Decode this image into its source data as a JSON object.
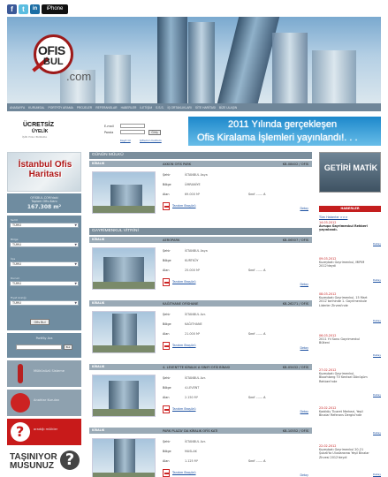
{
  "social": {
    "facebook": "f",
    "twitter": "t",
    "linkedin": "in",
    "iphone": "iPhone"
  },
  "logo": {
    "ofis": "OFIS",
    "bul": "BUL",
    "com": ".com"
  },
  "nav": [
    "ANASAYFA",
    "KURUMSAL",
    "PORTFÖY ARAMA",
    "PROJELER",
    "REFERANSLAR",
    "HABERLER",
    "İLETİŞİM",
    "S.S.S.",
    "İŞ ORTAKLIKLARI",
    "SİTE HARİTASI",
    "BİZE ULAŞIN"
  ],
  "member": {
    "title": "ÜCRETSİZ",
    "subtitle": "ÜYELİK",
    "small": "İŞİN YOLU BURADA",
    "email_label": "E-mail",
    "password_label": "Parola",
    "login_button": "Giriş",
    "register_link": "Kayıt Ol",
    "forgot_link": "Şifremi Unuttum"
  },
  "banner": {
    "line1": "2011 Yılında gerçekleşen",
    "line2": "Ofis Kiralama İşlemleri yayınlandı!. . ."
  },
  "left": {
    "istanbul_map": "İstanbul Ofis Haritası",
    "stat_line1": "OFİSBUL.COM'daki",
    "stat_line2": "Toplam Ofis Alanı",
    "stat_value": "167.308 m²",
    "search_labels": [
      "Semt",
      "Bölge",
      "İlçe",
      "Durum",
      "Fiyat Aralığı"
    ],
    "search_values": [
      "TÜMÜ",
      "TÜMÜ",
      "TÜMÜ",
      "TÜMÜ",
      "TÜMÜ"
    ],
    "search_button": "Ofis Bul",
    "portfoy_title": "Portföy Ara",
    "portfoy_button": "Bul",
    "banner1": "Mülkünüzü Sisteme",
    "banner2": "Anahtar Kurulan",
    "banner3": "aradığı mülkler",
    "tasiyor1": "TAŞINIYOR",
    "tasiyor2": "MUSUNUZ"
  },
  "main": {
    "section1": "GÜNÜN MÜLKÜ",
    "section2": "GAYRİMENKUL VİTRİNİ",
    "labels": {
      "sehir": "Şehir",
      "bolge": "Bölge",
      "alan": "Alan",
      "sinif": "Sınıf",
      "tanitim": "Tanıtım Broşürü",
      "detay": "Detay"
    },
    "listings": [
      {
        "type": "KİRALIK",
        "title": "AKKON OFİS PARK",
        "code": "KB-08402 / OFİS",
        "city": "İSTANBUL Asya",
        "region": "ÜMRANİYE",
        "area": "69.000 M²",
        "class": "A"
      },
      {
        "type": "KİRALIK",
        "title": "AEROPARK",
        "code": "KB-06507 / OFİS",
        "city": "İSTANBUL Asya",
        "region": "KURTKÖY",
        "area": "25.000 M²",
        "class": "A"
      },
      {
        "type": "KİRALIK",
        "title": "KAĞITHANE OFİSHANE",
        "code": "KB-26271 / OFİS",
        "city": "İSTANBUL Avr.",
        "region": "KAĞITHANE",
        "area": "21.000 M²",
        "class": "A"
      },
      {
        "type": "KİRALIK",
        "title": "4. LEVENT'TE KİRALIK A SINIFI OFİS BİNASI",
        "code": "KB-05432 / OFİS",
        "city": "İSTANBUL Avr.",
        "region": "4.LEVENT",
        "area": "2.150 M²",
        "class": "A"
      },
      {
        "type": "KİRALIK",
        "title": "PARK PLAZA' DA KİRALIK OFİS KATI",
        "code": "KB-10552 / OFİS",
        "city": "İSTANBUL Avr.",
        "region": "MASLAK",
        "area": "1.125 M²",
        "class": "A"
      }
    ]
  },
  "right": {
    "getiri": "GETİRİ MATİK",
    "haberler": "HABERLER",
    "tum": "Tüm Haberler >>>",
    "news": [
      {
        "date": "14.03.2012",
        "text": "Avrupa Gayrimenkul Rehberi yayınlandı.",
        "bold": true
      },
      {
        "date": "09.03.2012",
        "text": "Kuzeybatı Gayrimenkul, MIPIM 2012'deydi"
      },
      {
        "date": "08.03.2012",
        "text": "Kuzeybatı Gayrimenkul, 15 Mart 2012 tarihinde 1. Gayrimenkule Liderler Zirvesi'nde"
      },
      {
        "date": "06.03.2012",
        "text": "2011 Yıl Sonu Gayrimenkul Bülteni"
      },
      {
        "date": "27.02.2012",
        "text": "Kuzeybatı Gayrimenkul, Bloomberg TV Kentsel Dönüşüm Rehberi'nde"
      },
      {
        "date": "23.02.2012",
        "text": "Kadıköy Ticaret Merkezi, Yeşil Binalar Referans Dergisi'nde"
      },
      {
        "date": "22.02.2012",
        "text": "Kuzeybatı Gayrimenkul 20-21 Şubat'ta Uluslararası Yeşil Binalar Zirvesi 2012'deydi"
      }
    ],
    "detay": "Detay"
  }
}
